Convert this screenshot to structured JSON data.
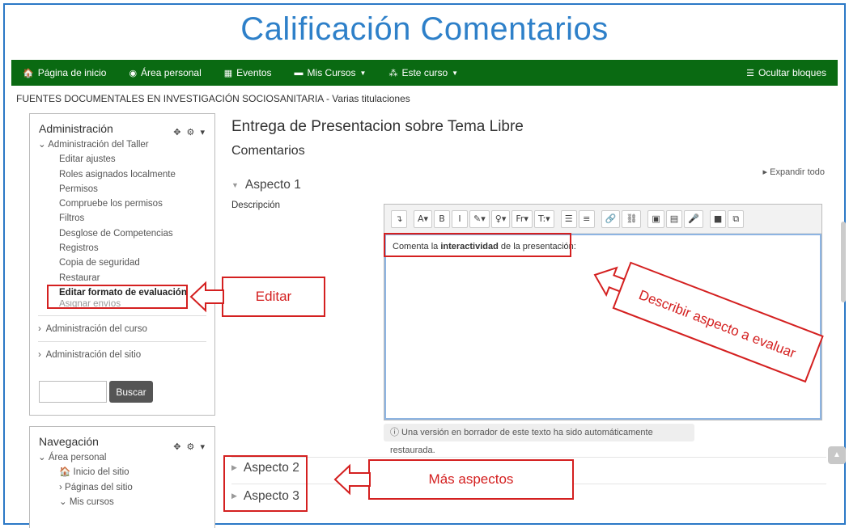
{
  "slide_title": "Calificación Comentarios",
  "navbar": {
    "home": "Página de inicio",
    "dashboard": "Área personal",
    "events": "Eventos",
    "my_courses": "Mis Cursos",
    "this_course": "Este curso",
    "hide_blocks": "Ocultar bloques"
  },
  "breadcrumb": "FUENTES DOCUMENTALES EN INVESTIGACIÓN SOCIOSANITARIA - Varias titulaciones",
  "admin_block": {
    "title": "Administración",
    "workshop_admin": "Administración del Taller",
    "items": [
      "Editar ajustes",
      "Roles asignados localmente",
      "Permisos",
      "Compruebe los permisos",
      "Filtros",
      "Desglose de Competencias",
      "Registros",
      "Copia de seguridad",
      "Restaurar",
      "Editar formato de evaluación",
      "Asignar envíos"
    ],
    "course_admin": "Administración del curso",
    "site_admin": "Administración del sitio",
    "search_button": "Buscar"
  },
  "nav_block": {
    "title": "Navegación",
    "dashboard": "Área personal",
    "site_home": "Inicio del sitio",
    "site_pages": "Páginas del sitio",
    "my_courses": "Mis cursos"
  },
  "main": {
    "heading": "Entrega de Presentacion sobre Tema Libre",
    "subheading": "Comentarios",
    "expand_all": "Expandir todo",
    "aspect1": "Aspecto 1",
    "description_label": "Descripción",
    "editor_text_before": "Comenta la ",
    "editor_text_bold": "interactividad",
    "editor_text_after": " de la presentación:",
    "draft_note": "ⓘ Una versión en borrador de este texto ha sido automáticamente restaurada.",
    "aspect2": "Aspecto 2",
    "aspect3": "Aspecto 3"
  },
  "toolbar_buttons": [
    "↴",
    "A▾",
    "B",
    "I",
    "✎▾",
    "♀▾",
    "Fr▾",
    "T:▾",
    "☰",
    "≡",
    "🔗",
    "⛓",
    "▣",
    "▤",
    "🎤",
    "■",
    "⧉"
  ],
  "annotations": {
    "edit": "Editar",
    "describe": "Describir aspecto a evaluar",
    "more": "Más aspectos"
  },
  "colors": {
    "navbar": "#0a6a12",
    "title": "#2e80c9",
    "annotation": "#d42020",
    "frame": "#2b78c6"
  }
}
